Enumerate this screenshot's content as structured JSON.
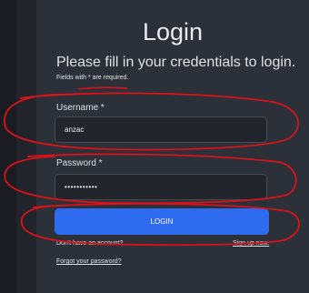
{
  "login": {
    "title": "Login",
    "subtitle": "Please fill in your credentials to login.",
    "required_note": "Fields with * are required.",
    "username_label": "Username *",
    "username_value": "anzac",
    "password_label": "Password *",
    "password_value": "•••••••••••",
    "button_label": "LOGIN",
    "signup_prompt": "Don't have an account?",
    "signup_link": "Sign up now.",
    "forgot_link": "Forgot your password?"
  },
  "colors": {
    "background": "#21242a",
    "card": "#2c3038",
    "input_bg": "#22252b",
    "button": "#2f6bef",
    "annotation_red": "#d8121b"
  }
}
